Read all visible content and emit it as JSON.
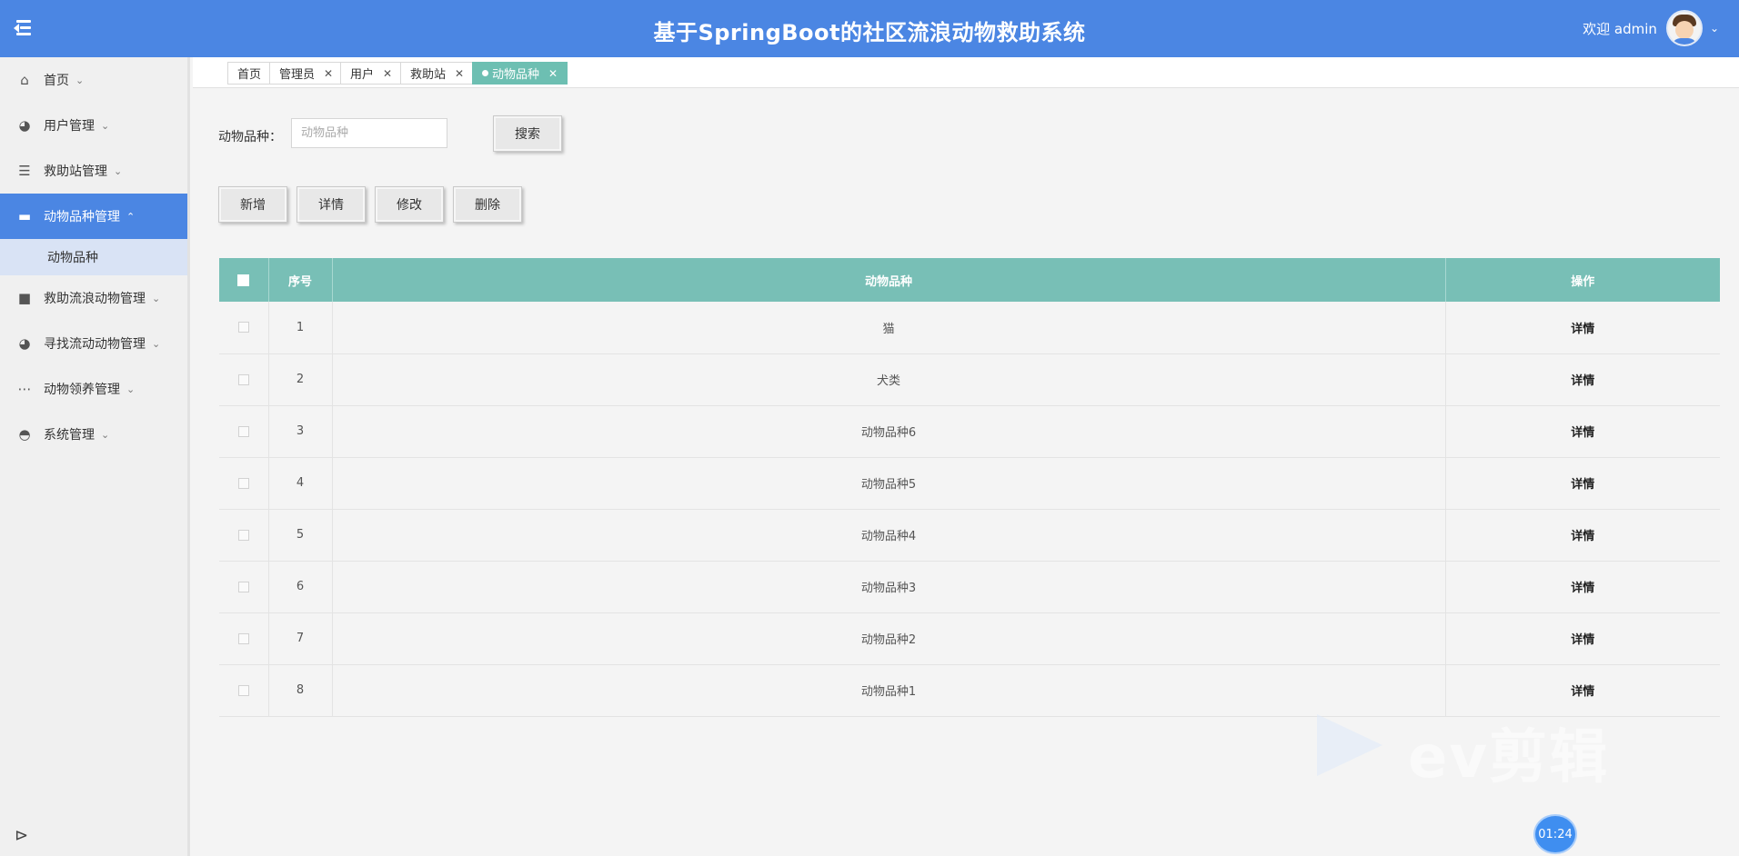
{
  "header": {
    "title": "基于SpringBoot的社区流浪动物救助系统",
    "welcome": "欢迎 admin"
  },
  "sidebar": {
    "items": [
      {
        "label": "首页",
        "icon": "home-icon"
      },
      {
        "label": "用户管理",
        "icon": "gauge-icon"
      },
      {
        "label": "救助站管理",
        "icon": "server-icon"
      },
      {
        "label": "动物品种管理",
        "icon": "monitor-icon",
        "active": true
      },
      {
        "label": "救助流浪动物管理",
        "icon": "briefcase-icon"
      },
      {
        "label": "寻找流动动物管理",
        "icon": "gauge-icon"
      },
      {
        "label": "动物领养管理",
        "icon": "dots-icon"
      },
      {
        "label": "系统管理",
        "icon": "spy-icon"
      }
    ],
    "sub_items": [
      {
        "label": "动物品种"
      }
    ]
  },
  "tabs": [
    {
      "label": "首页",
      "closable": false
    },
    {
      "label": "管理员",
      "closable": true
    },
    {
      "label": "用户",
      "closable": true
    },
    {
      "label": "救助站",
      "closable": true
    },
    {
      "label": "动物品种",
      "closable": true,
      "active": true
    }
  ],
  "search": {
    "label": "动物品种：",
    "placeholder": "动物品种",
    "value": "",
    "button": "搜索"
  },
  "toolbar": {
    "add": "新增",
    "detail": "详情",
    "edit": "修改",
    "delete": "删除"
  },
  "table": {
    "headers": [
      "序号",
      "动物品种",
      "操作"
    ],
    "rows": [
      {
        "no": "1",
        "breed": "猫",
        "action": "详情"
      },
      {
        "no": "2",
        "breed": "犬类",
        "action": "详情"
      },
      {
        "no": "3",
        "breed": "动物品种6",
        "action": "详情"
      },
      {
        "no": "4",
        "breed": "动物品种5",
        "action": "详情"
      },
      {
        "no": "5",
        "breed": "动物品种4",
        "action": "详情"
      },
      {
        "no": "6",
        "breed": "动物品种3",
        "action": "详情"
      },
      {
        "no": "7",
        "breed": "动物品种2",
        "action": "详情"
      },
      {
        "no": "8",
        "breed": "动物品种1",
        "action": "详情"
      }
    ]
  },
  "watermark": {
    "text": "ev剪辑"
  },
  "timer": {
    "text": "01:24"
  },
  "colors": {
    "header": "#4b86e3",
    "table_header": "#78bfb6",
    "active_tab": "#6dbfb2",
    "sub_item": "#d9e3f5"
  }
}
